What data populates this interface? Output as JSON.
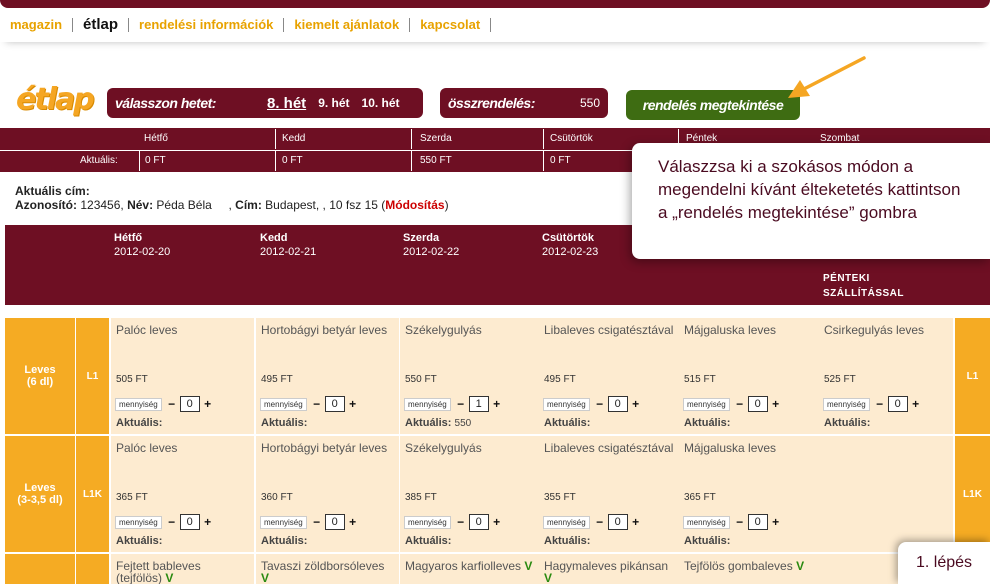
{
  "nav": {
    "items": [
      {
        "label": "magazin",
        "active": false
      },
      {
        "label": "étlap",
        "active": true
      },
      {
        "label": "rendelési információk",
        "active": false
      },
      {
        "label": "kiemelt ajánlatok",
        "active": false
      },
      {
        "label": "kapcsolat",
        "active": false
      }
    ]
  },
  "header": {
    "logo": "étlap",
    "week_label": "válasszon hetet:",
    "week_current": "8. hét",
    "week_options": [
      "9. hét",
      "10. hét"
    ],
    "total_label": "összrendelés:",
    "total_value": "550",
    "view_button": "rendelés megtekintése"
  },
  "days_band": {
    "days": [
      "Hétfő",
      "Kedd",
      "Szerda",
      "Csütörtök",
      "Péntek",
      "Szombat"
    ],
    "aktualis_label": "Aktuális:",
    "totals": [
      "0 FT",
      "0 FT",
      "550 FT",
      "0 FT"
    ]
  },
  "address": {
    "title": "Aktuális cím:",
    "id_label": "Azonosító:",
    "id_value": "123456",
    "name_label": "Név:",
    "name_value": "Péda Béla",
    "addr_label": "Cím:",
    "addr_value": "Budapest, , 10 fsz 15",
    "modify": "Módosítás"
  },
  "dates": {
    "days": [
      {
        "name": "Hétfő",
        "date": "2012-02-20"
      },
      {
        "name": "Kedd",
        "date": "2012-02-21"
      },
      {
        "name": "Szerda",
        "date": "2012-02-22"
      },
      {
        "name": "Csütörtök",
        "date": "2012-02-23"
      }
    ],
    "friday_delivery": [
      "PÉNTEKI",
      "SZÁLLÍTÁSSAL"
    ]
  },
  "menu": {
    "qty_label": "mennyiség",
    "aktualis_label": "Aktuális:",
    "rows": [
      {
        "category": "Leves",
        "portion": "(6 dl)",
        "code": "L1",
        "dishes": [
          {
            "name": "Palóc leves",
            "price": "505 FT",
            "qty": "0",
            "current": ""
          },
          {
            "name": "Hortobágyi betyár leves",
            "price": "495 FT",
            "qty": "0",
            "current": ""
          },
          {
            "name": "Székelygulyás",
            "price": "550 FT",
            "qty": "1",
            "current": "550"
          },
          {
            "name": "Libaleves csigatésztával",
            "price": "495 FT",
            "qty": "0",
            "current": ""
          },
          {
            "name": "Májgaluska leves",
            "price": "515 FT",
            "qty": "0",
            "current": ""
          },
          {
            "name": "Csirkegulyás leves",
            "price": "525 FT",
            "qty": "0",
            "current": ""
          }
        ]
      },
      {
        "category": "Leves",
        "portion": "(3-3,5 dl)",
        "code": "L1K",
        "dishes": [
          {
            "name": "Palóc leves",
            "price": "365 FT",
            "qty": "0",
            "current": ""
          },
          {
            "name": "Hortobágyi betyár leves",
            "price": "360 FT",
            "qty": "0",
            "current": ""
          },
          {
            "name": "Székelygulyás",
            "price": "385 FT",
            "qty": "0",
            "current": ""
          },
          {
            "name": "Libaleves csigatésztával",
            "price": "355 FT",
            "qty": "0",
            "current": ""
          },
          {
            "name": "Májgaluska leves",
            "price": "365 FT",
            "qty": "0",
            "current": ""
          }
        ]
      },
      {
        "dishes": [
          {
            "name": "Fejtett bableves (tejfölös)",
            "veg": "V"
          },
          {
            "name": "Tavaszi zöldborsóleves",
            "veg": "V"
          },
          {
            "name": "Magyaros karfiolleves",
            "veg": "V"
          },
          {
            "name": "Hagymaleves pikánsan",
            "veg": "V"
          },
          {
            "name": "Tejfölös gombaleves",
            "veg": "V"
          }
        ]
      }
    ]
  },
  "callout": {
    "text": "Válaszzsa ki a szokásos módon a megendelni kívánt élteketetés kattintson a „rendelés megtekintése” gombra"
  },
  "step": "1. lépés",
  "colors": {
    "maroon": "#6e0f23",
    "orange": "#f5ab23",
    "green": "#3e6c12",
    "cream": "#fdebd0"
  }
}
